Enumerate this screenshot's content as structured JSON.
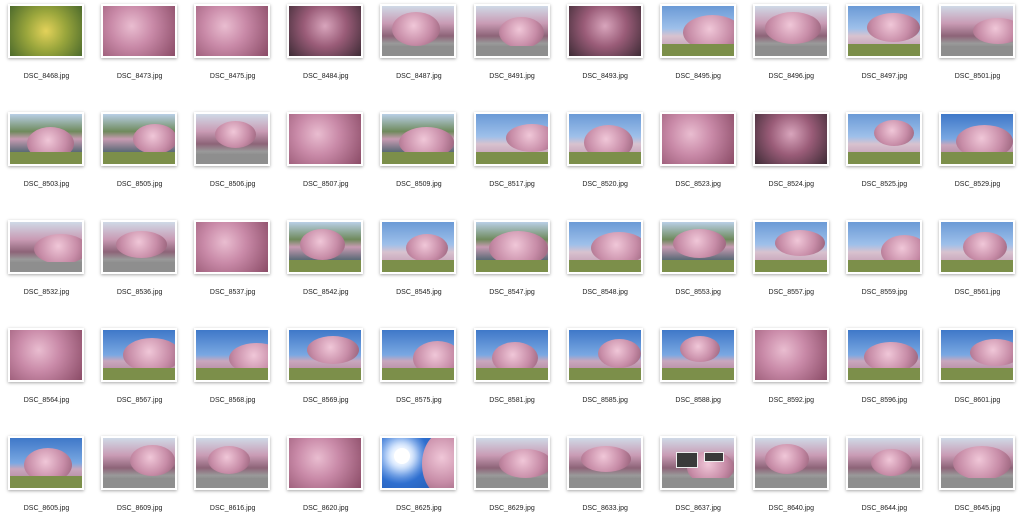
{
  "files": [
    {
      "name": "DSC_8468.jpg",
      "scene": "s-yellow"
    },
    {
      "name": "DSC_8473.jpg",
      "scene": "s-pink"
    },
    {
      "name": "DSC_8475.jpg",
      "scene": "s-pink"
    },
    {
      "name": "DSC_8484.jpg",
      "scene": "s-dark"
    },
    {
      "name": "DSC_8487.jpg",
      "scene": "s-road"
    },
    {
      "name": "DSC_8491.jpg",
      "scene": "s-road"
    },
    {
      "name": "DSC_8493.jpg",
      "scene": "s-dark"
    },
    {
      "name": "DSC_8495.jpg",
      "scene": "s-sky"
    },
    {
      "name": "DSC_8496.jpg",
      "scene": "s-road"
    },
    {
      "name": "DSC_8497.jpg",
      "scene": "s-sky"
    },
    {
      "name": "DSC_8501.jpg",
      "scene": "s-road"
    },
    {
      "name": "DSC_8503.jpg",
      "scene": "s-river"
    },
    {
      "name": "DSC_8505.jpg",
      "scene": "s-river"
    },
    {
      "name": "DSC_8506.jpg",
      "scene": "s-road"
    },
    {
      "name": "DSC_8507.jpg",
      "scene": "s-pink"
    },
    {
      "name": "DSC_8509.jpg",
      "scene": "s-river"
    },
    {
      "name": "DSC_8517.jpg",
      "scene": "s-sky"
    },
    {
      "name": "DSC_8520.jpg",
      "scene": "s-sky"
    },
    {
      "name": "DSC_8523.jpg",
      "scene": "s-pink"
    },
    {
      "name": "DSC_8524.jpg",
      "scene": "s-dark"
    },
    {
      "name": "DSC_8525.jpg",
      "scene": "s-sky"
    },
    {
      "name": "DSC_8529.jpg",
      "scene": "s-blue"
    },
    {
      "name": "DSC_8532.jpg",
      "scene": "s-road"
    },
    {
      "name": "DSC_8536.jpg",
      "scene": "s-road"
    },
    {
      "name": "DSC_8537.jpg",
      "scene": "s-pink"
    },
    {
      "name": "DSC_8542.jpg",
      "scene": "s-river"
    },
    {
      "name": "DSC_8545.jpg",
      "scene": "s-sky"
    },
    {
      "name": "DSC_8547.jpg",
      "scene": "s-river"
    },
    {
      "name": "DSC_8548.jpg",
      "scene": "s-sky"
    },
    {
      "name": "DSC_8553.jpg",
      "scene": "s-river"
    },
    {
      "name": "DSC_8557.jpg",
      "scene": "s-sky"
    },
    {
      "name": "DSC_8559.jpg",
      "scene": "s-sky"
    },
    {
      "name": "DSC_8561.jpg",
      "scene": "s-sky"
    },
    {
      "name": "DSC_8564.jpg",
      "scene": "s-pink"
    },
    {
      "name": "DSC_8567.jpg",
      "scene": "s-blue"
    },
    {
      "name": "DSC_8568.jpg",
      "scene": "s-blue"
    },
    {
      "name": "DSC_8569.jpg",
      "scene": "s-blue"
    },
    {
      "name": "DSC_8575.jpg",
      "scene": "s-blue"
    },
    {
      "name": "DSC_8581.jpg",
      "scene": "s-blue"
    },
    {
      "name": "DSC_8585.jpg",
      "scene": "s-blue"
    },
    {
      "name": "DSC_8588.jpg",
      "scene": "s-blue"
    },
    {
      "name": "DSC_8592.jpg",
      "scene": "s-pink"
    },
    {
      "name": "DSC_8596.jpg",
      "scene": "s-blue"
    },
    {
      "name": "DSC_8601.jpg",
      "scene": "s-blue"
    },
    {
      "name": "DSC_8605.jpg",
      "scene": "s-blue"
    },
    {
      "name": "DSC_8609.jpg",
      "scene": "s-road"
    },
    {
      "name": "DSC_8616.jpg",
      "scene": "s-road"
    },
    {
      "name": "DSC_8620.jpg",
      "scene": "s-pink"
    },
    {
      "name": "DSC_8625.jpg",
      "scene": "s-sun"
    },
    {
      "name": "DSC_8629.jpg",
      "scene": "s-road"
    },
    {
      "name": "DSC_8633.jpg",
      "scene": "s-road"
    },
    {
      "name": "DSC_8637.jpg",
      "scene": "s-road"
    },
    {
      "name": "DSC_8640.jpg",
      "scene": "s-road"
    },
    {
      "name": "DSC_8644.jpg",
      "scene": "s-road"
    },
    {
      "name": "DSC_8645.jpg",
      "scene": "s-road"
    }
  ]
}
